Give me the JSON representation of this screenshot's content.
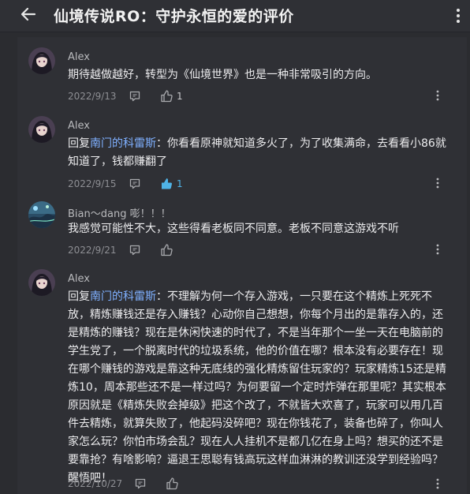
{
  "header": {
    "title": "仙境传说RO：守护永恒的爱的评价",
    "back_icon": "arrow-left-icon",
    "more_icon": "more-vertical-icon"
  },
  "comments": [
    {
      "author": "Alex",
      "reply_prefix": "",
      "reply_to": "",
      "text": "期待越做越好，转型为《仙境世界》也是一种非常吸引的方向。",
      "date": "2022/9/13",
      "likes": "1",
      "liked": false
    },
    {
      "author": "Alex",
      "reply_prefix": "回复",
      "reply_to": "南门的科雷斯",
      "text": "：你看看原神就知道多火了，为了收集满命，去看看小86就知道了，钱都赚翻了",
      "date": "2022/9/15",
      "likes": "1",
      "liked": true
    },
    {
      "author": "Bian～dang 嘭！！！",
      "reply_prefix": "",
      "reply_to": "",
      "text": "我感觉可能性不大，这些得看老板同不同意。老板不同意这游戏不听",
      "date": "2022/9/21",
      "likes": "",
      "liked": false
    },
    {
      "author": "Alex",
      "reply_prefix": "回复",
      "reply_to": "南门的科雷斯",
      "text": "：不理解为何一个存入游戏，一只要在这个精炼上死死不放，精炼赚钱还是存入赚钱？心动你自己想想，你每个月出的是靠存入的，还是精炼的赚钱？现在是休闲快速的时代了，不是当年那个一坐一天在电脑前的学生党了，一个脱离时代的垃圾系统，他的价值在哪？根本没有必要存在！现在哪个赚钱的游戏是靠这种无底线的强化精炼留住玩家的？玩家精炼15还是精炼10，周本那些还不是一样过吗？为何要留一个定时炸弹在那里呢？其实根本原因就是《精炼失败会掉级》把这个改了，不就皆大欢喜了，玩家可以用几百件去精炼，就算失败了，他起码没碎吧？现在你钱花了，装备也碎了，你叫人家怎么玩？你怕市场会乱？现在人人挂机不是都几亿在身上吗？想买的还不是要靠抢？有啥影响？逼退王思聪有钱高玩这样血淋淋的教训还没学到经验吗？醒悟吧！",
      "date": "2022/10/27",
      "likes": "",
      "liked": false
    }
  ],
  "colors": {
    "background": "#2b2c30",
    "panel": "#2f3035",
    "reply_link": "#7fb0ff",
    "like_active": "#4fb3e6"
  }
}
